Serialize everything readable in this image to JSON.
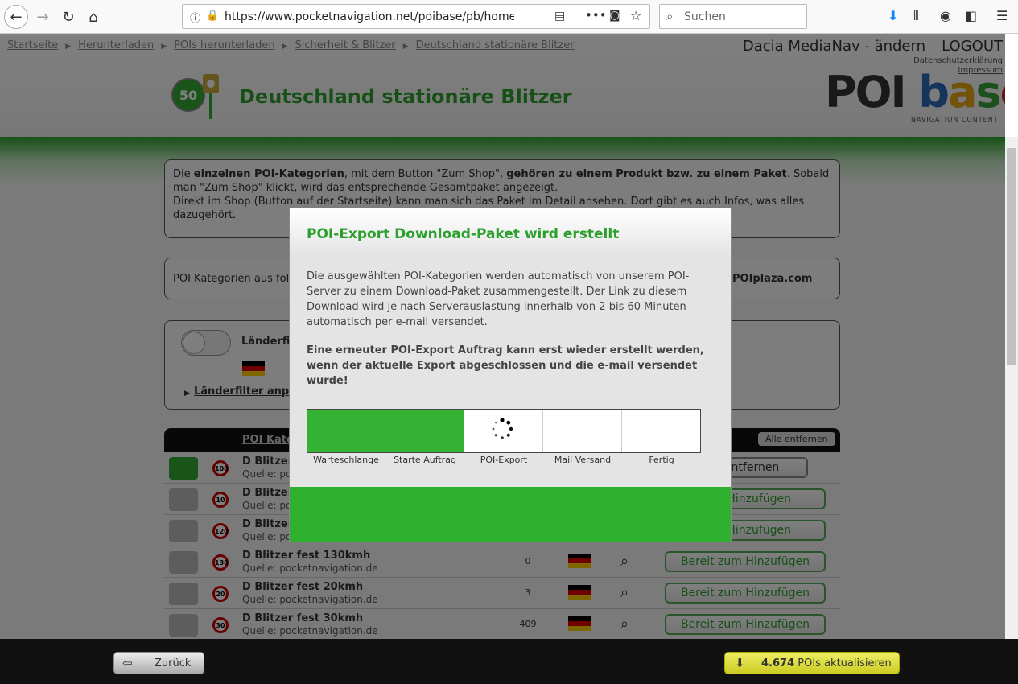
{
  "browser": {
    "url": "https://www.pocketnavigation.net/poibase/pb/home/downloa",
    "search_placeholder": "Suchen"
  },
  "header": {
    "breadcrumbs": [
      "Startseite",
      "Herunterladen",
      "POIs herunterladen",
      "Sicherheit & Blitzer",
      "Deutschland stationäre Blitzer"
    ],
    "device": "Dacia MediaNav - ändern",
    "logout": "LOGOUT",
    "privacy": "Datenschutzerklärung",
    "imprint": "Impressum",
    "logo_poi": "POI",
    "logo_base": [
      "b",
      "a",
      "s",
      "e"
    ],
    "logo_sub": "NAVIGATION CONTENT",
    "title": "Deutschland stationäre Blitzer",
    "sign_number": "50"
  },
  "info": {
    "text_1": "Die ",
    "bold_1": "einzelnen POI-Kategorien",
    "text_2": ", mit dem Button \"Zum Shop\", ",
    "bold_2": "gehören zu einem Produkt bzw. zu einem Paket",
    "text_3": ". Sobald man \"Zum Shop\" klickt, wird das entsprechende Gesamtpaket angezeigt.",
    "text_4": "Direkt im Shop (Button auf der Startseite) kann man sich das Paket im Detail ansehen. Dort gibt es auch Infos, was alles dazugehört."
  },
  "filter2": {
    "left": "POI Kategorien aus fol",
    "right": "POIplaza.com"
  },
  "filter": {
    "label": "Länderfil",
    "link": "Länderfilter anpa"
  },
  "table": {
    "header": "POI Kate",
    "remove_all": "Alle entfernen",
    "rows": [
      {
        "speed": "100",
        "name": "D Blitzer",
        "source": "Quelle: poc",
        "count": "",
        "button": "Entfernen"
      },
      {
        "speed": "10",
        "name": "D Blitzer",
        "source": "Quelle: poc",
        "count": "",
        "button": "zum Hinzufügen"
      },
      {
        "speed": "120",
        "name": "D Blitzer",
        "source": "Quelle: poc",
        "count": "",
        "button": "zum Hinzufügen"
      },
      {
        "speed": "130",
        "name": "D Blitzer fest 130kmh",
        "source": "Quelle: pocketnavigation.de",
        "count": "0",
        "button": "Bereit zum Hinzufügen"
      },
      {
        "speed": "20",
        "name": "D Blitzer fest 20kmh",
        "source": "Quelle: pocketnavigation.de",
        "count": "3",
        "button": "Bereit zum Hinzufügen"
      },
      {
        "speed": "30",
        "name": "D Blitzer fest 30kmh",
        "source": "Quelle: pocketnavigation.de",
        "count": "409",
        "button": "Bereit zum Hinzufügen"
      }
    ]
  },
  "modal": {
    "title": "POI-Export Download-Paket wird erstellt",
    "text": "Die ausgewählten POI-Kategorien werden automatisch von unserem POI-Server zu einem Download-Paket zusammengestellt. Der Link zu diesem Download wird je nach Serverauslastung innerhalb von 2 bis 60 Minuten automatisch per e-mail versendet.",
    "warning": "Eine erneuter POI-Export Auftrag kann erst wieder erstellt werden, wenn der aktuelle Export abgeschlossen und die e-mail versendet wurde!",
    "steps": [
      "Warteschlange",
      "Starte Auftrag",
      "POI-Export",
      "Mail Versand",
      "Fertig"
    ],
    "steps_completed": 2,
    "active_step": "POI-Export"
  },
  "bottom": {
    "back": "Zurück",
    "update_count": "4.674",
    "update_label": " POIs aktualisieren"
  },
  "colors": {
    "accent_green": "#2ca02c",
    "step_done": "#33b233"
  }
}
